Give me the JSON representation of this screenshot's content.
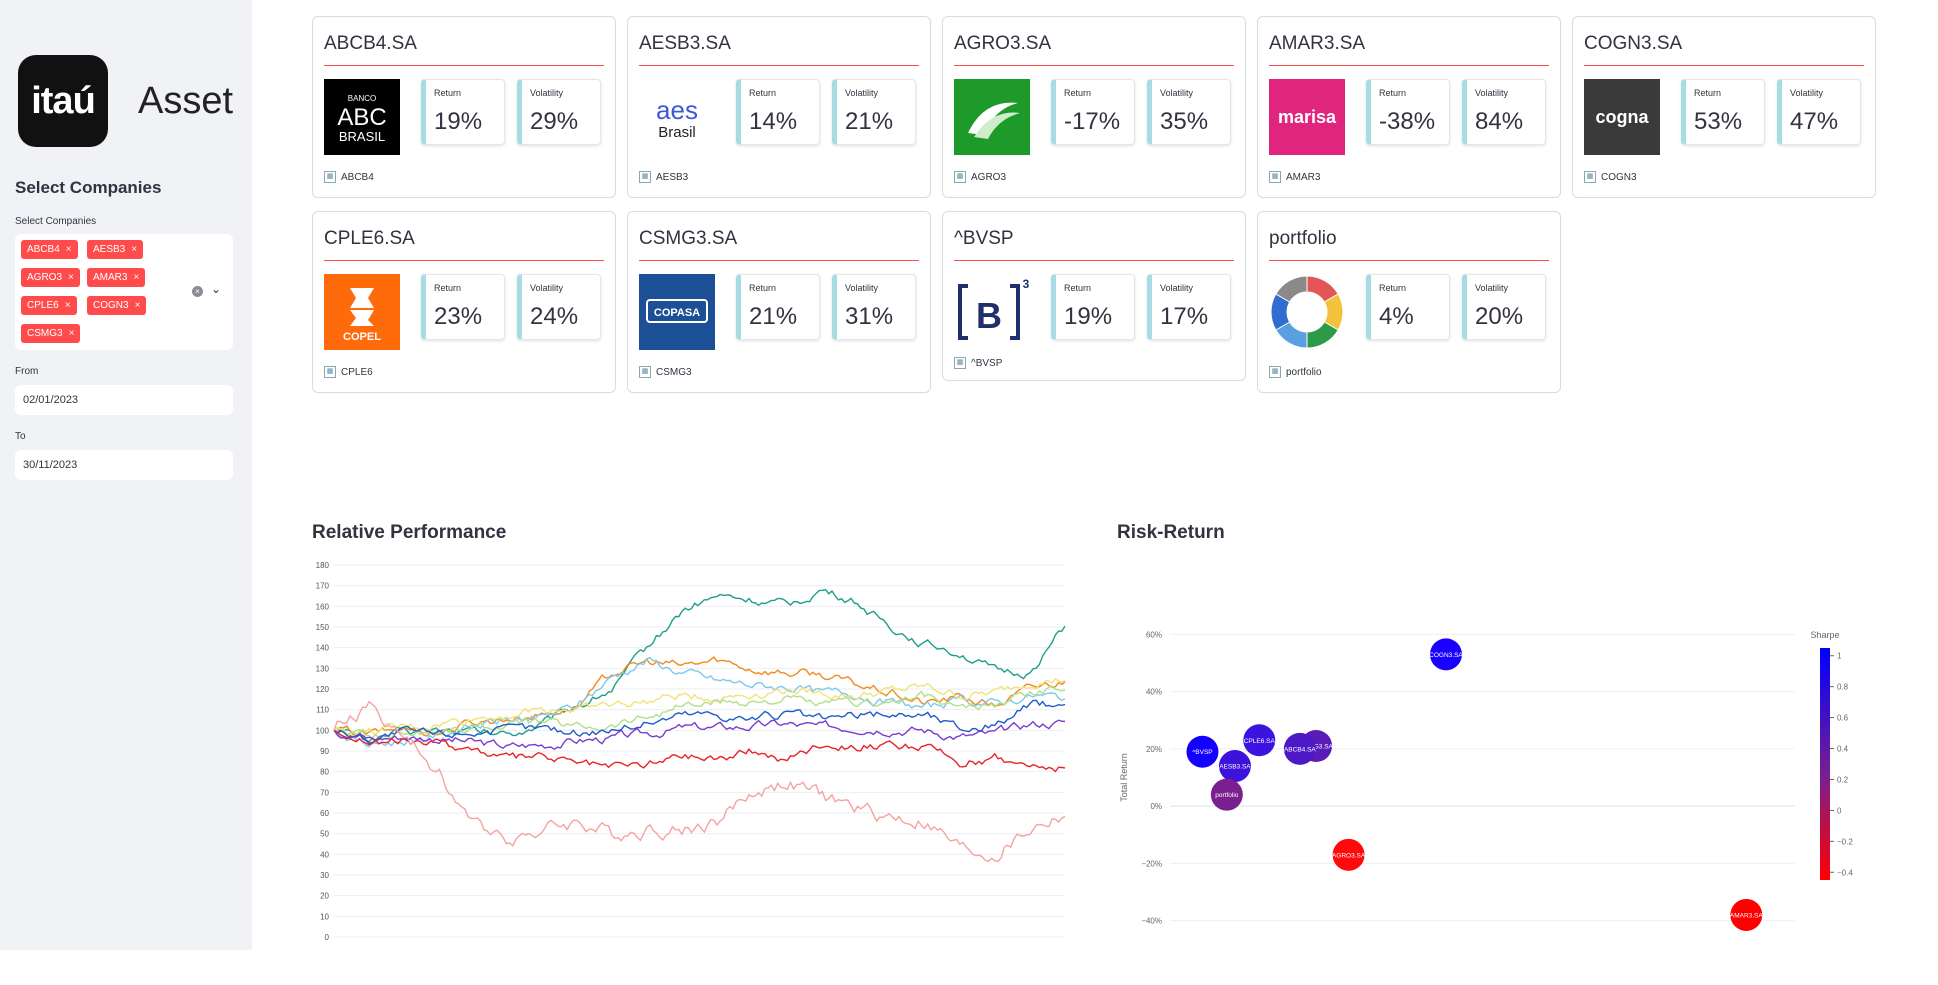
{
  "sidebar": {
    "logo_text": "itaú",
    "logo_sub": "Asset",
    "section_title": "Select Companies",
    "select_label": "Select Companies",
    "selected": [
      "ABCB4",
      "AESB3",
      "AGRO3",
      "AMAR3",
      "CPLE6",
      "COGN3",
      "CSMG3"
    ],
    "tag_close": "×",
    "clear_icon": "×",
    "caret_icon": "⌄",
    "from_label": "From",
    "from_value": "02/01/2023",
    "to_label": "To",
    "to_value": "30/11/2023"
  },
  "cards": [
    {
      "title": "ABCB4.SA",
      "return": "19%",
      "volatility": "29%",
      "foot": "ABCB4",
      "logo": {
        "kind": "abc",
        "bg": "#000000",
        "lines": [
          "BANCO",
          "ABC",
          "BRASIL"
        ]
      }
    },
    {
      "title": "AESB3.SA",
      "return": "14%",
      "volatility": "21%",
      "foot": "AESB3",
      "logo": {
        "kind": "aes",
        "bg": "#ffffff",
        "lines": [
          "aes",
          "Brasil"
        ]
      }
    },
    {
      "title": "AGRO3.SA",
      "return": "-17%",
      "volatility": "35%",
      "foot": "AGRO3",
      "logo": {
        "kind": "agro",
        "bg": "#1e9a2b",
        "lines": []
      }
    },
    {
      "title": "AMAR3.SA",
      "return": "-38%",
      "volatility": "84%",
      "foot": "AMAR3",
      "logo": {
        "kind": "text",
        "bg": "#e0257f",
        "lines": [
          "marisa"
        ]
      }
    },
    {
      "title": "COGN3.SA",
      "return": "53%",
      "volatility": "47%",
      "foot": "COGN3",
      "logo": {
        "kind": "text",
        "bg": "#3a3a3a",
        "lines": [
          "cogna"
        ]
      }
    },
    {
      "title": "CPLE6.SA",
      "return": "23%",
      "volatility": "24%",
      "foot": "CPLE6",
      "logo": {
        "kind": "copel",
        "bg": "#ff6a0b",
        "lines": [
          "COPEL"
        ]
      }
    },
    {
      "title": "CSMG3.SA",
      "return": "21%",
      "volatility": "31%",
      "foot": "CSMG3",
      "logo": {
        "kind": "copasa",
        "bg": "#1d4f96",
        "lines": [
          "COPASA"
        ]
      }
    },
    {
      "title": "^BVSP",
      "return": "19%",
      "volatility": "17%",
      "foot": "^BVSP",
      "logo": {
        "kind": "b3",
        "bg": "#ffffff",
        "lines": [
          "B",
          "3"
        ]
      }
    },
    {
      "title": "portfolio",
      "return": "4%",
      "volatility": "20%",
      "foot": "portfolio",
      "logo": {
        "kind": "donut",
        "bg": "#ffffff",
        "lines": []
      }
    }
  ],
  "metric_labels": {
    "return": "Return",
    "volatility": "Volatility"
  },
  "colors": {
    "accent": "#ff4b4b",
    "metric_border": "#a8dce5",
    "sidebar_bg": "#f0f2f6"
  },
  "relative_performance": {
    "title": "Relative Performance"
  },
  "risk_return": {
    "title": "Risk-Return"
  },
  "chart_data": [
    {
      "type": "line",
      "title": "Relative Performance",
      "ylim": [
        0,
        180
      ],
      "yticks": [
        0,
        10,
        20,
        30,
        40,
        50,
        60,
        70,
        80,
        90,
        100,
        110,
        120,
        130,
        140,
        150,
        160,
        170,
        180
      ],
      "points_per_series": 230,
      "series": [
        {
          "color": "#1f9e89",
          "anchors": [
            100,
            96,
            99,
            100,
            99,
            98,
            103,
            112,
            120,
            140,
            158,
            165,
            163,
            160,
            168,
            162,
            150,
            142,
            138,
            128,
            128,
            150
          ]
        },
        {
          "color": "#f08c1a",
          "anchors": [
            100,
            98,
            101,
            99,
            104,
            106,
            108,
            112,
            128,
            133,
            131,
            134,
            130,
            128,
            127,
            122,
            118,
            113,
            116,
            112,
            120,
            124
          ]
        },
        {
          "color": "#7ec8f0",
          "anchors": [
            100,
            93,
            95,
            98,
            102,
            105,
            106,
            112,
            126,
            134,
            128,
            124,
            122,
            121,
            118,
            118,
            113,
            111,
            114,
            113,
            117,
            116
          ]
        },
        {
          "color": "#f2e27a",
          "anchors": [
            100,
            99,
            101,
            103,
            106,
            108,
            110,
            111,
            112,
            114,
            117,
            116,
            118,
            120,
            118,
            117,
            119,
            121,
            117,
            118,
            124,
            125
          ]
        },
        {
          "color": "#b2df8a",
          "anchors": [
            100,
            97,
            99,
            100,
            101,
            103,
            104,
            102,
            103,
            107,
            112,
            113,
            114,
            115,
            112,
            113,
            114,
            116,
            110,
            112,
            118,
            120
          ]
        },
        {
          "color": "#1f5cc9",
          "anchors": [
            100,
            96,
            99,
            98,
            100,
            100,
            101,
            99,
            101,
            104,
            108,
            108,
            106,
            108,
            105,
            107,
            108,
            108,
            101,
            103,
            112,
            113
          ]
        },
        {
          "color": "#7b3bd0",
          "anchors": [
            100,
            96,
            97,
            96,
            94,
            92,
            93,
            95,
            96,
            98,
            101,
            101,
            102,
            103,
            101,
            102,
            101,
            100,
            97,
            98,
            103,
            104
          ]
        },
        {
          "color": "#e8232a",
          "anchors": [
            100,
            95,
            94,
            93,
            91,
            86,
            87,
            84,
            82,
            84,
            88,
            87,
            90,
            86,
            94,
            93,
            92,
            92,
            84,
            87,
            83,
            82
          ]
        },
        {
          "color": "#f5a3a0",
          "anchors": [
            100,
            112,
            96,
            80,
            54,
            49,
            52,
            56,
            50,
            53,
            52,
            56,
            70,
            75,
            68,
            62,
            58,
            56,
            42,
            40,
            52,
            60
          ]
        }
      ]
    },
    {
      "type": "scatter",
      "title": "Risk-Return",
      "ylabel": "Total Return",
      "ylim": [
        -45,
        65
      ],
      "yticks": [
        60,
        40,
        20,
        0,
        -20,
        -40
      ],
      "ytick_labels": [
        "60%",
        "40%",
        "20%",
        "0%",
        "−20%",
        "−40%"
      ],
      "xlim": [
        0.13,
        0.9
      ],
      "points": [
        {
          "label": "COGN3.SA",
          "x": 0.47,
          "y": 53,
          "color": "#1a00ff"
        },
        {
          "label": "CPLE6.SA",
          "x": 0.24,
          "y": 23,
          "color": "#3b13e0"
        },
        {
          "label": "CSMG3.SA",
          "x": 0.31,
          "y": 21,
          "color": "#5b1bb8"
        },
        {
          "label": "ABCB4.SA",
          "x": 0.29,
          "y": 20,
          "color": "#4d18c6"
        },
        {
          "label": "^BVSP",
          "x": 0.17,
          "y": 19,
          "color": "#1400ff"
        },
        {
          "label": "AESB3.SA",
          "x": 0.21,
          "y": 14,
          "color": "#3d12dc"
        },
        {
          "label": "portfolio",
          "x": 0.2,
          "y": 4,
          "color": "#7a1f8f"
        },
        {
          "label": "AGRO3.SA",
          "x": 0.35,
          "y": -17,
          "color": "#ff0a0a"
        },
        {
          "label": "AMAR3.SA",
          "x": 0.84,
          "y": -38,
          "color": "#ff0000"
        }
      ],
      "colorbar": {
        "title": "Sharpe",
        "ticks": [
          "1",
          "0.8",
          "0.6",
          "0.4",
          "0.2",
          "0",
          "−0.2",
          "−0.4"
        ],
        "top_color": "#0000ff",
        "bottom_color": "#ff0000"
      }
    }
  ]
}
